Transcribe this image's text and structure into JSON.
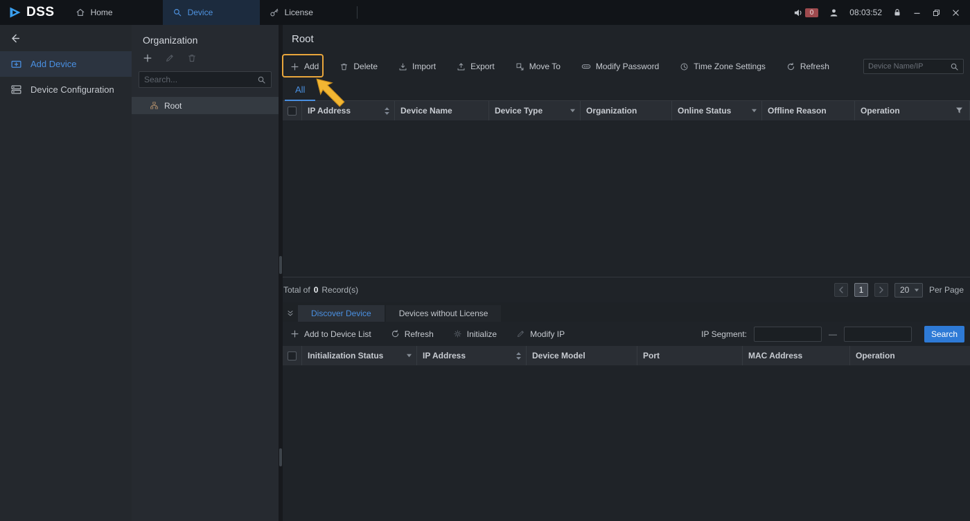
{
  "titlebar": {
    "logo_text": "DSS",
    "tabs": [
      {
        "label": "Home"
      },
      {
        "label": "Device"
      },
      {
        "label": "License"
      }
    ],
    "notification_badge": "0",
    "clock": "08:03:52"
  },
  "sidebar": {
    "items": [
      {
        "label": "Add Device"
      },
      {
        "label": "Device Configuration"
      }
    ]
  },
  "organization": {
    "title": "Organization",
    "search_placeholder": "Search...",
    "root_label": "Root"
  },
  "main": {
    "title": "Root",
    "toolbar": [
      {
        "label": "Add"
      },
      {
        "label": "Delete"
      },
      {
        "label": "Import"
      },
      {
        "label": "Export"
      },
      {
        "label": "Move To"
      },
      {
        "label": "Modify Password"
      },
      {
        "label": "Time Zone Settings"
      },
      {
        "label": "Refresh"
      }
    ],
    "search_placeholder": "Device Name/IP",
    "tab_all": "All",
    "columns": [
      "IP Address",
      "Device Name",
      "Device Type",
      "Organization",
      "Online Status",
      "Offline Reason",
      "Operation"
    ],
    "rows": [],
    "footer": {
      "total_prefix": "Total of",
      "total_count": "0",
      "total_suffix": "Record(s)",
      "current_page": "1",
      "page_size": "20",
      "per_page_label": "Per Page"
    }
  },
  "discover": {
    "tabs": [
      {
        "label": "Discover Device"
      },
      {
        "label": "Devices without License"
      }
    ],
    "toolbar": [
      {
        "label": "Add to Device List"
      },
      {
        "label": "Refresh"
      },
      {
        "label": "Initialize"
      },
      {
        "label": "Modify IP"
      }
    ],
    "ip_segment_label": "IP Segment:",
    "range_separator": "—",
    "search_button_label": "Search",
    "columns": [
      "Initialization Status",
      "IP Address",
      "Device Model",
      "Port",
      "MAC Address",
      "Operation"
    ],
    "rows": []
  },
  "colors": {
    "accent_blue": "#4a90e2",
    "annotation_orange": "#e9a63c",
    "search_button_blue": "#2e7ad6",
    "badge_red": "#9e4a4e"
  }
}
